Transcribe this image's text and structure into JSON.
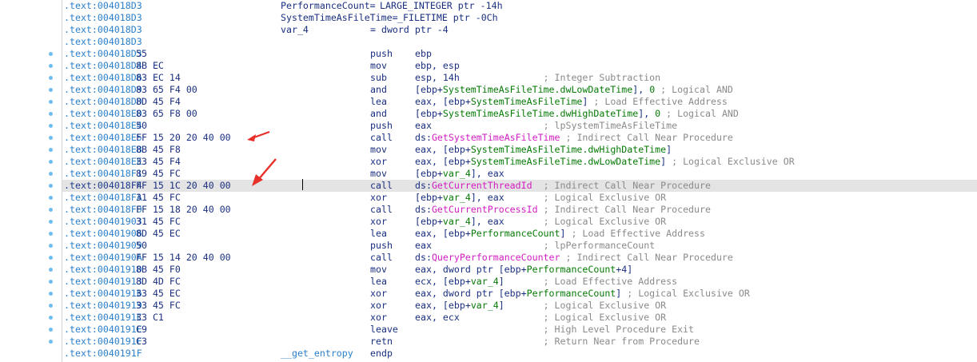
{
  "locals": [
    {
      "addr": ".text:004018D3",
      "name": "PerformanceCount=",
      "def": "LARGE_INTEGER ptr -14h"
    },
    {
      "addr": ".text:004018D3",
      "name": "SystemTimeAsFileTime=",
      "def": "_FILETIME ptr -0Ch"
    },
    {
      "addr": ".text:004018D3",
      "name": "var_4",
      "def": "= dword ptr -4"
    },
    {
      "addr": ".text:004018D3"
    }
  ],
  "instructions": [
    {
      "addr": ".text:004018D3",
      "bytes": "55",
      "mnem": "push",
      "ops": "ebp",
      "cmt": ""
    },
    {
      "addr": ".text:004018D4",
      "bytes": "8B EC",
      "mnem": "mov",
      "ops": "ebp, esp",
      "cmt": ""
    },
    {
      "addr": ".text:004018D6",
      "bytes": "83 EC 14",
      "mnem": "sub",
      "ops": "esp, 14h",
      "cmt": "; Integer Subtraction"
    },
    {
      "addr": ".text:004018D9",
      "bytes": "83 65 F4 00",
      "mnem": "and",
      "ops": "[ebp+SystemTimeAsFileTime.dwLowDateTime], 0",
      "cmt": "; Logical AND"
    },
    {
      "addr": ".text:004018DD",
      "bytes": "8D 45 F4",
      "mnem": "lea",
      "ops": "eax, [ebp+SystemTimeAsFileTime]",
      "cmt": "; Load Effective Address"
    },
    {
      "addr": ".text:004018E0",
      "bytes": "83 65 F8 00",
      "mnem": "and",
      "ops": "[ebp+SystemTimeAsFileTime.dwHighDateTime], 0",
      "cmt": "; Logical AND"
    },
    {
      "addr": ".text:004018E4",
      "bytes": "50",
      "mnem": "push",
      "ops": "eax",
      "cmt": "; lpSystemTimeAsFileTime"
    },
    {
      "addr": ".text:004018E5",
      "bytes": "FF 15 20 20 40 00",
      "mnem": "call",
      "ops": "ds:GetSystemTimeAsFileTime",
      "cmt": "; Indirect Call Near Procedure"
    },
    {
      "addr": ".text:004018EB",
      "bytes": "8B 45 F8",
      "mnem": "mov",
      "ops": "eax, [ebp+SystemTimeAsFileTime.dwHighDateTime]",
      "cmt": ""
    },
    {
      "addr": ".text:004018EE",
      "bytes": "33 45 F4",
      "mnem": "xor",
      "ops": "eax, [ebp+SystemTimeAsFileTime.dwLowDateTime]",
      "cmt": "; Logical Exclusive OR"
    },
    {
      "addr": ".text:004018F1",
      "bytes": "89 45 FC",
      "mnem": "mov",
      "ops": "[ebp+var_4], eax",
      "cmt": ""
    },
    {
      "addr": ".text:004018F4",
      "bytes": "FF 15 1C 20 40 00",
      "mnem": "call",
      "ops": "ds:GetCurrentThreadId",
      "cmt": "; Indirect Call Near Procedure"
    },
    {
      "addr": ".text:004018FA",
      "bytes": "31 45 FC",
      "mnem": "xor",
      "ops": "[ebp+var_4], eax",
      "cmt": "; Logical Exclusive OR"
    },
    {
      "addr": ".text:004018FD",
      "bytes": "FF 15 18 20 40 00",
      "mnem": "call",
      "ops": "ds:GetCurrentProcessId",
      "cmt": "; Indirect Call Near Procedure"
    },
    {
      "addr": ".text:00401903",
      "bytes": "31 45 FC",
      "mnem": "xor",
      "ops": "[ebp+var_4], eax",
      "cmt": "; Logical Exclusive OR"
    },
    {
      "addr": ".text:00401906",
      "bytes": "8D 45 EC",
      "mnem": "lea",
      "ops": "eax, [ebp+PerformanceCount]",
      "cmt": "; Load Effective Address"
    },
    {
      "addr": ".text:00401909",
      "bytes": "50",
      "mnem": "push",
      "ops": "eax",
      "cmt": "; lpPerformanceCount"
    },
    {
      "addr": ".text:0040190A",
      "bytes": "FF 15 14 20 40 00",
      "mnem": "call",
      "ops": "ds:QueryPerformanceCounter",
      "cmt": "; Indirect Call Near Procedure"
    },
    {
      "addr": ".text:00401910",
      "bytes": "8B 45 F0",
      "mnem": "mov",
      "ops": "eax, dword ptr [ebp+PerformanceCount+4]",
      "cmt": ""
    },
    {
      "addr": ".text:00401913",
      "bytes": "8D 4D FC",
      "mnem": "lea",
      "ops": "ecx, [ebp+var_4]",
      "cmt": "; Load Effective Address"
    },
    {
      "addr": ".text:00401916",
      "bytes": "33 45 EC",
      "mnem": "xor",
      "ops": "eax, dword ptr [ebp+PerformanceCount]",
      "cmt": "; Logical Exclusive OR"
    },
    {
      "addr": ".text:00401919",
      "bytes": "33 45 FC",
      "mnem": "xor",
      "ops": "eax, [ebp+var_4]",
      "cmt": "; Logical Exclusive OR"
    },
    {
      "addr": ".text:0040191C",
      "bytes": "33 C1",
      "mnem": "xor",
      "ops": "eax, ecx",
      "cmt": "; Logical Exclusive OR"
    },
    {
      "addr": ".text:0040191E",
      "bytes": "C9",
      "mnem": "leave",
      "ops": "",
      "cmt": "; High Level Procedure Exit"
    },
    {
      "addr": ".text:0040191F",
      "bytes": "C3",
      "mnem": "retn",
      "ops": "",
      "cmt": "; Return Near from Procedure"
    }
  ],
  "footer": {
    "addr": ".text:0040191F",
    "label": "__get_entropy",
    "directive": "endp"
  },
  "current_address": ".text:004018F4",
  "colors": {
    "address": "#2b80cc",
    "code": "#1a2f80",
    "variable": "#067a06",
    "api": "#d21cc2",
    "comment": "#8a8a8a",
    "arrow": "#e8302a",
    "highlight": "#e4e4e4"
  }
}
